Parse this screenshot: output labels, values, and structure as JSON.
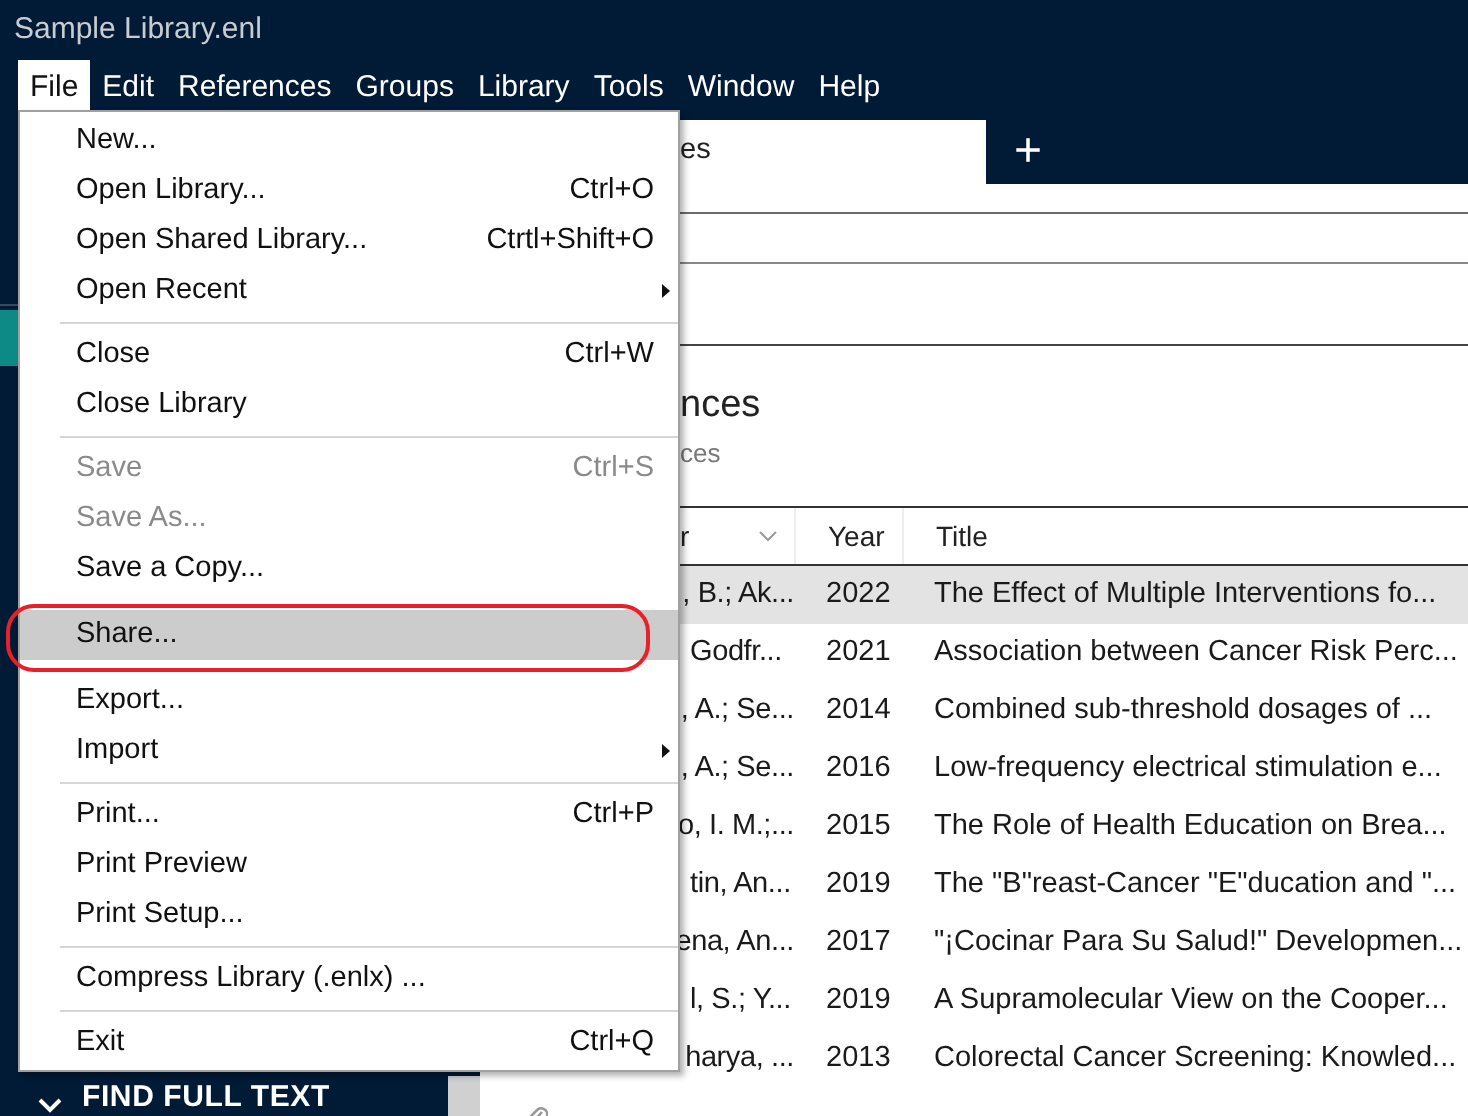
{
  "window": {
    "title": "Sample Library.enl"
  },
  "menu_bar": [
    {
      "label": "File",
      "selected": true
    },
    {
      "label": "Edit",
      "selected": false
    },
    {
      "label": "References",
      "selected": false
    },
    {
      "label": "Groups",
      "selected": false
    },
    {
      "label": "Library",
      "selected": false
    },
    {
      "label": "Tools",
      "selected": false
    },
    {
      "label": "Window",
      "selected": false
    },
    {
      "label": "Help",
      "selected": false
    }
  ],
  "file_menu": {
    "groups": [
      [
        {
          "label": "New...",
          "disabled": false,
          "selected": false
        },
        {
          "label": "Open Library...",
          "shortcut": "Ctrl+O",
          "disabled": false,
          "selected": false
        },
        {
          "label": "Open Shared Library...",
          "shortcut": "Ctrtl+Shift+O",
          "disabled": false,
          "selected": false
        },
        {
          "label": "Open Recent",
          "submenu": true,
          "disabled": false,
          "selected": false
        }
      ],
      [
        {
          "label": "Close",
          "shortcut": "Ctrl+W",
          "disabled": false,
          "selected": false
        },
        {
          "label": "Close Library",
          "disabled": false,
          "selected": false
        }
      ],
      [
        {
          "label": "Save",
          "shortcut": "Ctrl+S",
          "disabled": true,
          "selected": false
        },
        {
          "label": "Save As...",
          "disabled": true,
          "selected": false
        },
        {
          "label": "Save a Copy...",
          "disabled": false,
          "selected": false
        },
        {
          "label": "Share...",
          "disabled": false,
          "selected": true
        },
        {
          "label": "Export...",
          "disabled": false,
          "selected": false
        },
        {
          "label": "Import",
          "submenu": true,
          "disabled": false,
          "selected": false
        }
      ],
      [
        {
          "label": "Print...",
          "shortcut": "Ctrl+P",
          "disabled": false,
          "selected": false
        },
        {
          "label": "Print Preview",
          "disabled": false,
          "selected": false
        },
        {
          "label": "Print Setup...",
          "disabled": false,
          "selected": false
        }
      ],
      [
        {
          "label": "Compress Library (.enlx) ...",
          "disabled": false,
          "selected": false
        }
      ],
      [
        {
          "label": "Exit",
          "shortcut": "Ctrl+Q",
          "disabled": false,
          "selected": false
        }
      ]
    ]
  },
  "sidebar": {
    "bottom_section": "FIND FULL TEXT"
  },
  "tabs": [
    {
      "label": "es",
      "selected": true
    }
  ],
  "new_tab_button": "+",
  "heading": {
    "title": "nces",
    "subtitle": "ces"
  },
  "table": {
    "columns": [
      "r",
      "Year",
      "Title"
    ],
    "rows": [
      {
        "author": ", B.; Ak...",
        "year": "2022",
        "title": "The Effect of Multiple Interventions fo...",
        "selected": true
      },
      {
        "author": "Godfr...",
        "year": "2021",
        "title": "Association between Cancer Risk Perc...",
        "selected": false
      },
      {
        "author": ", A.; Se...",
        "year": "2014",
        "title": "Combined sub-threshold dosages of ...",
        "selected": false
      },
      {
        "author": ", A.; Se...",
        "year": "2016",
        "title": "Low-frequency electrical stimulation e...",
        "selected": false
      },
      {
        "author": "o, I. M.;...",
        "year": "2015",
        "title": "The Role of Health Education on Brea...",
        "selected": false
      },
      {
        "author": "tin, An...",
        "year": "2019",
        "title": "The \"B\"reast-Cancer \"E\"ducation and \"...",
        "selected": false
      },
      {
        "author": "ena, An...",
        "year": "2017",
        "title": "\"¡Cocinar Para Su Salud!\" Developmen...",
        "selected": false
      },
      {
        "author": "l, S.; Y...",
        "year": "2019",
        "title": "A Supramolecular View on the Cooper...",
        "selected": false
      },
      {
        "author": "harya, ...",
        "year": "2013",
        "title": "Colorectal Cancer Screening: Knowled...",
        "selected": false
      },
      {
        "selected": false,
        "attachment": true
      }
    ]
  }
}
